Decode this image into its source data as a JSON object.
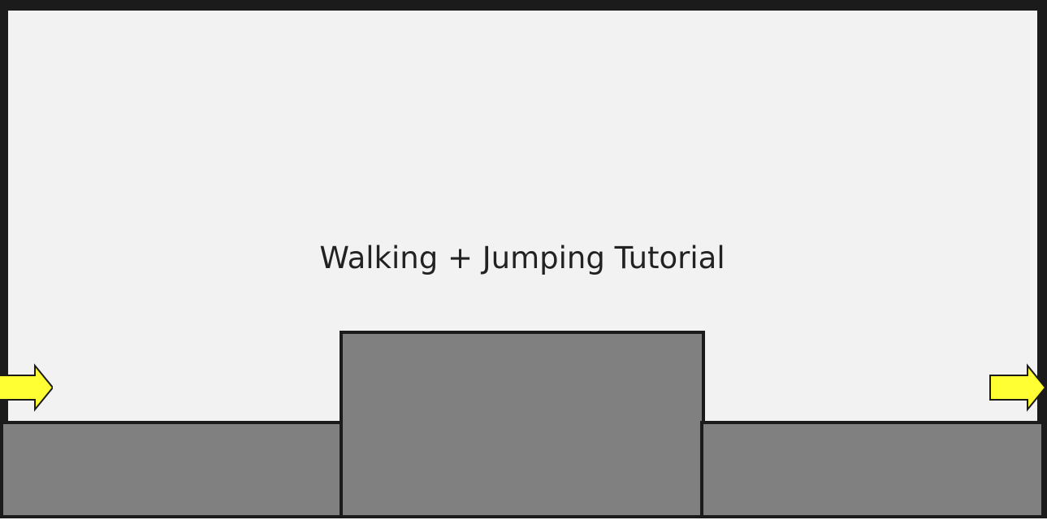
{
  "level": {
    "title": "Walking + Jumping Tutorial"
  },
  "colors": {
    "background": "#f2f2f2",
    "wall": "#1b1b1b",
    "platform": "#808080",
    "arrow_fill": "#ffff33",
    "arrow_stroke": "#1b1b1b",
    "text": "#222222"
  },
  "icons": {
    "entry": "arrow-right-icon",
    "exit": "arrow-right-icon"
  }
}
